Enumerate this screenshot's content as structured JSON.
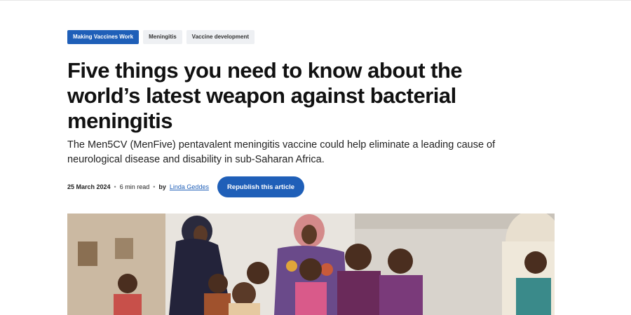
{
  "tags": [
    {
      "label": "Making Vaccines Work"
    },
    {
      "label": "Meningitis"
    },
    {
      "label": "Vaccine development"
    }
  ],
  "headline": "Five things you need to know about the world’s latest weapon against bacterial meningitis",
  "standfirst": "The Men5CV (MenFive) pentavalent meningitis vaccine could help eliminate a leading cause of neurological disease and disability in sub-Saharan Africa.",
  "meta": {
    "date": "25 March 2024",
    "separator": "•",
    "read_time": "6 min read",
    "by": "by",
    "author": "Linda Geddes"
  },
  "republish_label": "Republish this article",
  "colors": {
    "accent": "#1f5fb8",
    "tag_bg": "#eef0f3"
  }
}
